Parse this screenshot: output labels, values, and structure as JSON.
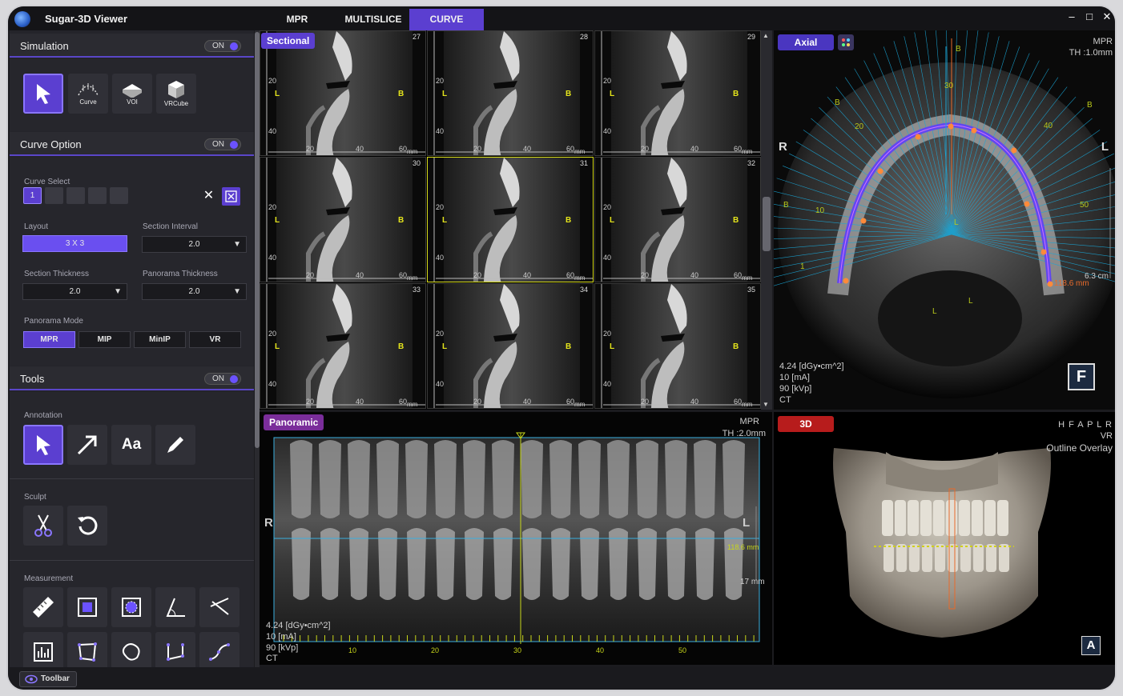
{
  "app": {
    "title": "Sugar-3D Viewer"
  },
  "tabs": [
    "MPR",
    "MULTISLICE",
    "CURVE"
  ],
  "active_tab": "CURVE",
  "window_controls": {
    "minimize": "–",
    "maximize": "□",
    "close": "✕"
  },
  "accent_color": "#5b3fd0",
  "left_panel": {
    "simulation": {
      "title": "Simulation",
      "toggle": "ON",
      "tools": [
        {
          "label": "",
          "icon": "pointer-icon"
        },
        {
          "label": "Curve",
          "icon": "curve-icon"
        },
        {
          "label": "VOI",
          "icon": "voi-icon"
        },
        {
          "label": "VRCube",
          "icon": "vrcube-icon"
        }
      ]
    },
    "curve_option": {
      "title": "Curve Option",
      "toggle": "ON",
      "curve_select_label": "Curve Select",
      "curve_slots": [
        "1",
        "",
        "",
        "",
        ""
      ],
      "layout_label": "Layout",
      "layout_value": "3 X 3",
      "section_interval_label": "Section Interval",
      "section_interval_value": "2.0",
      "section_thickness_label": "Section Thickness",
      "section_thickness_value": "2.0",
      "panorama_thickness_label": "Panorama Thickness",
      "panorama_thickness_value": "2.0",
      "panorama_mode_label": "Panorama Mode",
      "panorama_modes": [
        "MPR",
        "MIP",
        "MinIP",
        "VR"
      ],
      "panorama_mode_active": "MPR"
    },
    "tools": {
      "title": "Tools",
      "toggle": "ON",
      "annotation_label": "Annotation",
      "sculpt_label": "Sculpt",
      "measurement_label": "Measurement"
    }
  },
  "sectional": {
    "tag": "Sectional",
    "cells": [
      "27",
      "28",
      "29",
      "30",
      "31",
      "32",
      "33",
      "34",
      "35"
    ],
    "selected_cell": "31",
    "left_marker": "L",
    "right_marker": "B",
    "y_ticks": [
      "20",
      "40"
    ],
    "x_ticks": [
      "20",
      "40",
      "60"
    ],
    "unit": "mm"
  },
  "axial": {
    "tag": "Axial",
    "mode": "MPR",
    "thickness": "TH :1.0mm",
    "orient_left": "R",
    "orient_right": "L",
    "orient_bottom": "F",
    "dose": "4.24  [dGy•cm^2]",
    "ma": "10 [mA]",
    "kvp": "90 [kVp]",
    "modality": "CT",
    "length": "118.6 mm",
    "scale": "6.3 cm",
    "arch_labels": [
      "B",
      "30",
      "B",
      "20",
      "40",
      "B",
      "B",
      "10",
      "50",
      "1",
      "L",
      "L",
      "L"
    ]
  },
  "panoramic": {
    "tag": "Panoramic",
    "mode": "MPR",
    "thickness": "TH :2.0mm",
    "orient_left": "R",
    "orient_right": "L",
    "length": "118.6 mm",
    "depth": "17 mm",
    "dose": "4.24  [dGy•cm^2]",
    "ma": "10 [mA]",
    "kvp": "90 [kVp]",
    "modality": "CT",
    "x_ticks": [
      "10",
      "20",
      "30",
      "40",
      "50"
    ]
  },
  "vr3d": {
    "tag": "3D",
    "orientation": "H F A P L R",
    "mode": "VR",
    "overlay": "Outline Overlay",
    "orient_corner": "A"
  },
  "footer": {
    "toolbar_label": "Toolbar"
  }
}
